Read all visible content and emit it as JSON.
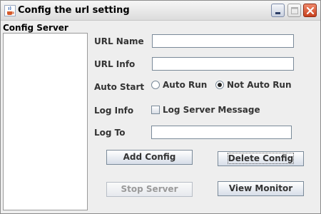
{
  "window": {
    "title": "Config the url setting",
    "icon": "java-cup-icon",
    "controls": [
      "minimize-icon",
      "maximize-icon",
      "close-icon"
    ]
  },
  "server_panel": {
    "label": "Config Server",
    "items": []
  },
  "form": {
    "url_name": {
      "label": "URL Name",
      "value": ""
    },
    "url_info": {
      "label": "URL Info",
      "value": ""
    },
    "auto_start": {
      "label": "Auto Start",
      "options": [
        "Auto Run",
        "Not Auto Run"
      ],
      "selected": "Not Auto Run"
    },
    "log_info": {
      "label": "Log Info",
      "checkbox_label": "Log Server Message",
      "checked": false
    },
    "log_to": {
      "label": "Log To",
      "value": ""
    }
  },
  "buttons": {
    "add_config": "Add Config",
    "delete_config": "Delete Config",
    "stop_server": "Stop Server",
    "view_monitor": "View Monitor"
  }
}
